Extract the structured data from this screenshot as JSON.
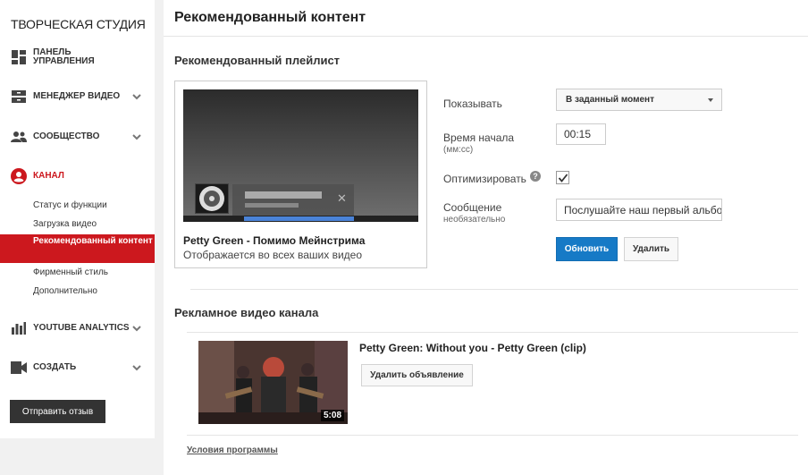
{
  "sidebar": {
    "studio_title": "ТВОРЧЕСКАЯ СТУДИЯ",
    "items": [
      {
        "label": "ПАНЕЛЬ УПРАВЛЕНИЯ",
        "icon": "dashboard-icon"
      },
      {
        "label": "МЕНЕДЖЕР ВИДЕО",
        "icon": "video-manager-icon"
      },
      {
        "label": "СООБЩЕСТВО",
        "icon": "community-icon"
      },
      {
        "label": "КАНАЛ",
        "icon": "channel-icon"
      },
      {
        "label": "YOUTUBE ANALYTICS",
        "icon": "analytics-icon"
      },
      {
        "label": "СОЗДАТЬ",
        "icon": "create-icon"
      }
    ],
    "channel_subitems": [
      "Статус и функции",
      "Загрузка видео",
      "Рекомендованный контент",
      "Фирменный стиль",
      "Дополнительно"
    ],
    "feedback_label": "Отправить отзыв"
  },
  "main": {
    "title": "Рекомендованный контент",
    "playlist_section": {
      "title": "Рекомендованный плейлист",
      "playlist_name": "Petty Green - Помимо Мейнстрима",
      "playlist_desc": "Отображается во всех ваших видео",
      "show_label": "Показывать",
      "show_value": "В заданный момент",
      "start_time_label": "Время начала",
      "start_time_sublabel": "(мм:сс)",
      "start_time_value": "00:15",
      "optimize_label": "Оптимизировать",
      "optimize_checked": true,
      "message_label": "Сообщение",
      "message_sublabel": "необязательно",
      "message_value": "Послушайте наш первый альбом",
      "update_label": "Обновить",
      "delete_label": "Удалить"
    },
    "ad_section": {
      "title": "Рекламное видео канала",
      "video_title": "Petty Green: Without you - Petty Green (clip)",
      "duration": "5:08",
      "remove_label": "Удалить объявление"
    },
    "terms_label": "Условия программы"
  },
  "colors": {
    "accent_red": "#cc181e",
    "primary_blue": "#167ac6"
  }
}
